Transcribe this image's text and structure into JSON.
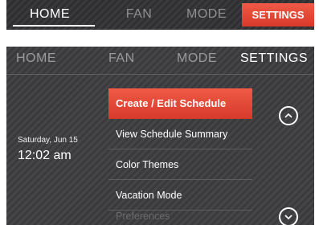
{
  "top_nav": {
    "tabs": [
      "HOME",
      "FAN",
      "MODE"
    ],
    "active": "SETTINGS"
  },
  "main_nav": {
    "tabs": [
      "HOME",
      "FAN",
      "MODE",
      "SETTINGS"
    ]
  },
  "clock": {
    "date": "Saturday, Jun 15",
    "time": "12:02 am"
  },
  "menu": {
    "items": [
      "Create / Edit Schedule",
      "View Schedule Summary",
      "Color Themes",
      "Vacation Mode",
      "Preferences"
    ]
  },
  "icons": {
    "up": "chevron-up-icon",
    "down": "chevron-down-icon"
  },
  "colors": {
    "accent": "#e84b3b",
    "panel": "#3f3f41"
  }
}
